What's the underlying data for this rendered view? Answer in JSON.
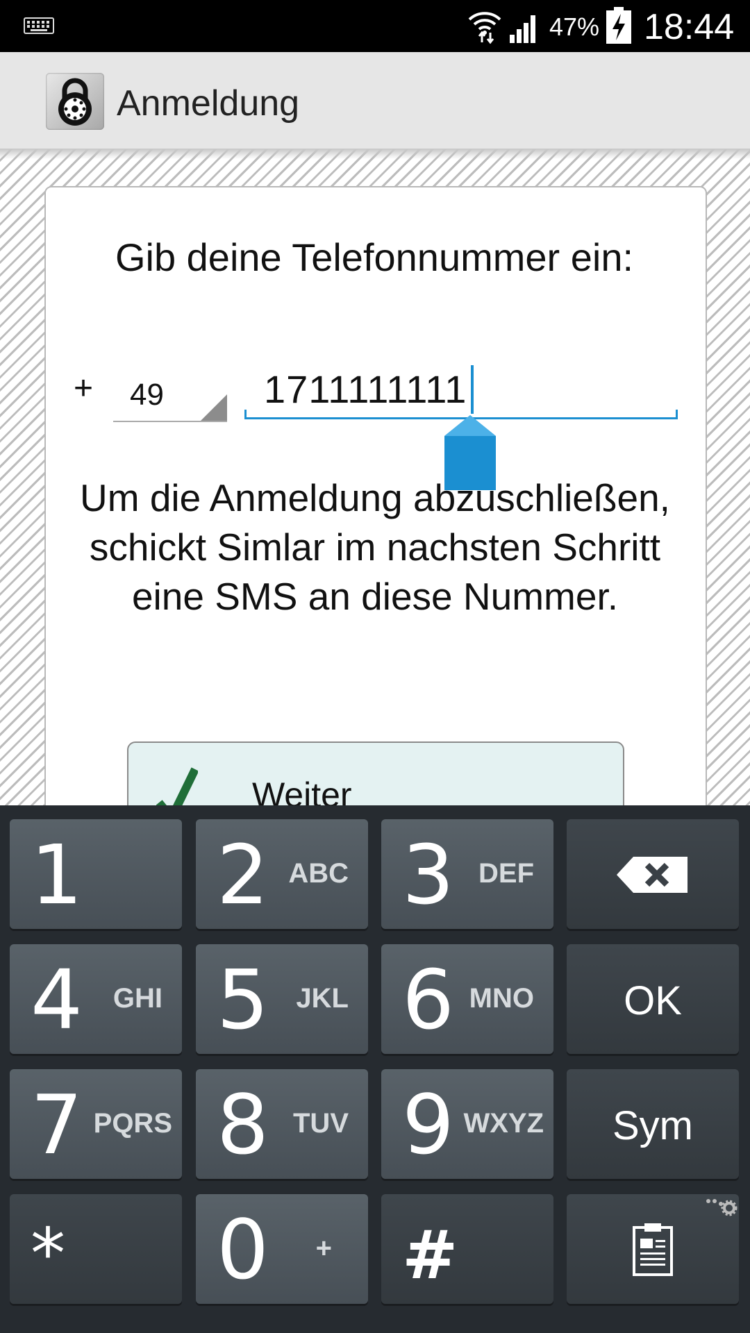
{
  "status_bar": {
    "battery_percent": "47%",
    "time": "18:44",
    "icons": [
      "keyboard-icon",
      "wifi-icon",
      "signal-icon",
      "battery-charging-icon"
    ]
  },
  "action_bar": {
    "title": "Anmeldung",
    "icon": "lock-dial-icon"
  },
  "form": {
    "prompt": "Gib deine Telefonnummer ein:",
    "plus_sign": "+",
    "country_code": "49",
    "phone_number": "1711111111",
    "info_text": "Um die Anmeldung abzuschließen, schickt Simlar im nachsten Schritt eine SMS an diese Nummer.",
    "continue_label": "Weiter"
  },
  "keyboard": {
    "keys": [
      {
        "main": "1",
        "sub": ""
      },
      {
        "main": "2",
        "sub": "ABC"
      },
      {
        "main": "3",
        "sub": "DEF"
      },
      {
        "main": "",
        "sub": "",
        "icon": "backspace-icon"
      },
      {
        "main": "4",
        "sub": "GHI"
      },
      {
        "main": "5",
        "sub": "JKL"
      },
      {
        "main": "6",
        "sub": "MNO"
      },
      {
        "main": "OK",
        "sub": ""
      },
      {
        "main": "7",
        "sub": "PQRS"
      },
      {
        "main": "8",
        "sub": "TUV"
      },
      {
        "main": "9",
        "sub": "WXYZ"
      },
      {
        "main": "Sym",
        "sub": ""
      },
      {
        "main": "*",
        "sub": ""
      },
      {
        "main": "0",
        "sub": "+"
      },
      {
        "main": "#",
        "sub": ""
      },
      {
        "main": "",
        "sub": "",
        "icon": "clipboard-icon"
      }
    ]
  },
  "colors": {
    "accent": "#1b8fd1",
    "keyboard_bg": "#262b30",
    "button_bg": "#e4f2f2"
  }
}
